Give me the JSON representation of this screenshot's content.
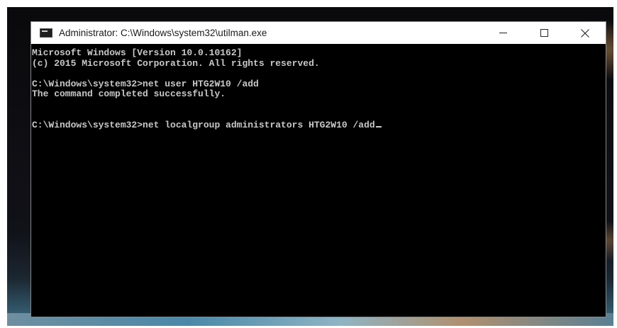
{
  "window": {
    "title": "Administrator: C:\\Windows\\system32\\utilman.exe",
    "icon": "console-icon",
    "controls": {
      "minimize": "minimize-icon",
      "maximize": "maximize-icon",
      "close": "close-icon"
    }
  },
  "console": {
    "lines": [
      "Microsoft Windows [Version 10.0.10162]",
      "(c) 2015 Microsoft Corporation. All rights reserved.",
      "",
      "C:\\Windows\\system32>net user HTG2W10 /add",
      "The command completed successfully.",
      "",
      "",
      "C:\\Windows\\system32>net localgroup administrators HTG2W10 /add"
    ]
  },
  "colors": {
    "console_background": "#000000",
    "console_text": "#c8c8c8",
    "titlebar_background": "#ffffff"
  }
}
